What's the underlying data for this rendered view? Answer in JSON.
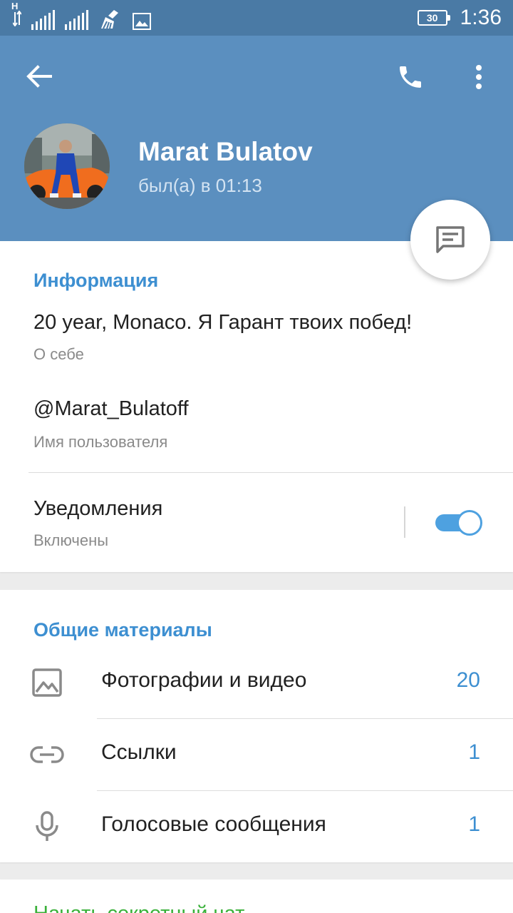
{
  "status_bar": {
    "network_type": "H",
    "battery": "30",
    "time": "1:36"
  },
  "header": {
    "contact_name": "Marat Bulatov",
    "last_seen": "был(а) в 01:13"
  },
  "info": {
    "section_title": "Информация",
    "bio": "20 year, Monaco. Я Гарант твоих побед!",
    "bio_label": "О себе",
    "username": "@Marat_Bulatoff",
    "username_label": "Имя пользователя",
    "notifications_label": "Уведомления",
    "notifications_status": "Включены",
    "notifications_enabled": true
  },
  "shared_media": {
    "section_title": "Общие материалы",
    "items": [
      {
        "icon": "photo-icon",
        "label": "Фотографии и видео",
        "count": "20"
      },
      {
        "icon": "link-icon",
        "label": "Ссылки",
        "count": "1"
      },
      {
        "icon": "mic-icon",
        "label": "Голосовые сообщения",
        "count": "1"
      }
    ]
  },
  "secret_chat": {
    "label": "Начать секретный чат"
  },
  "colors": {
    "header_bg": "#5b8fbf",
    "status_bar_bg": "#4a7aa5",
    "accent_blue": "#3d8fd1",
    "accent_green": "#3bb13b"
  }
}
